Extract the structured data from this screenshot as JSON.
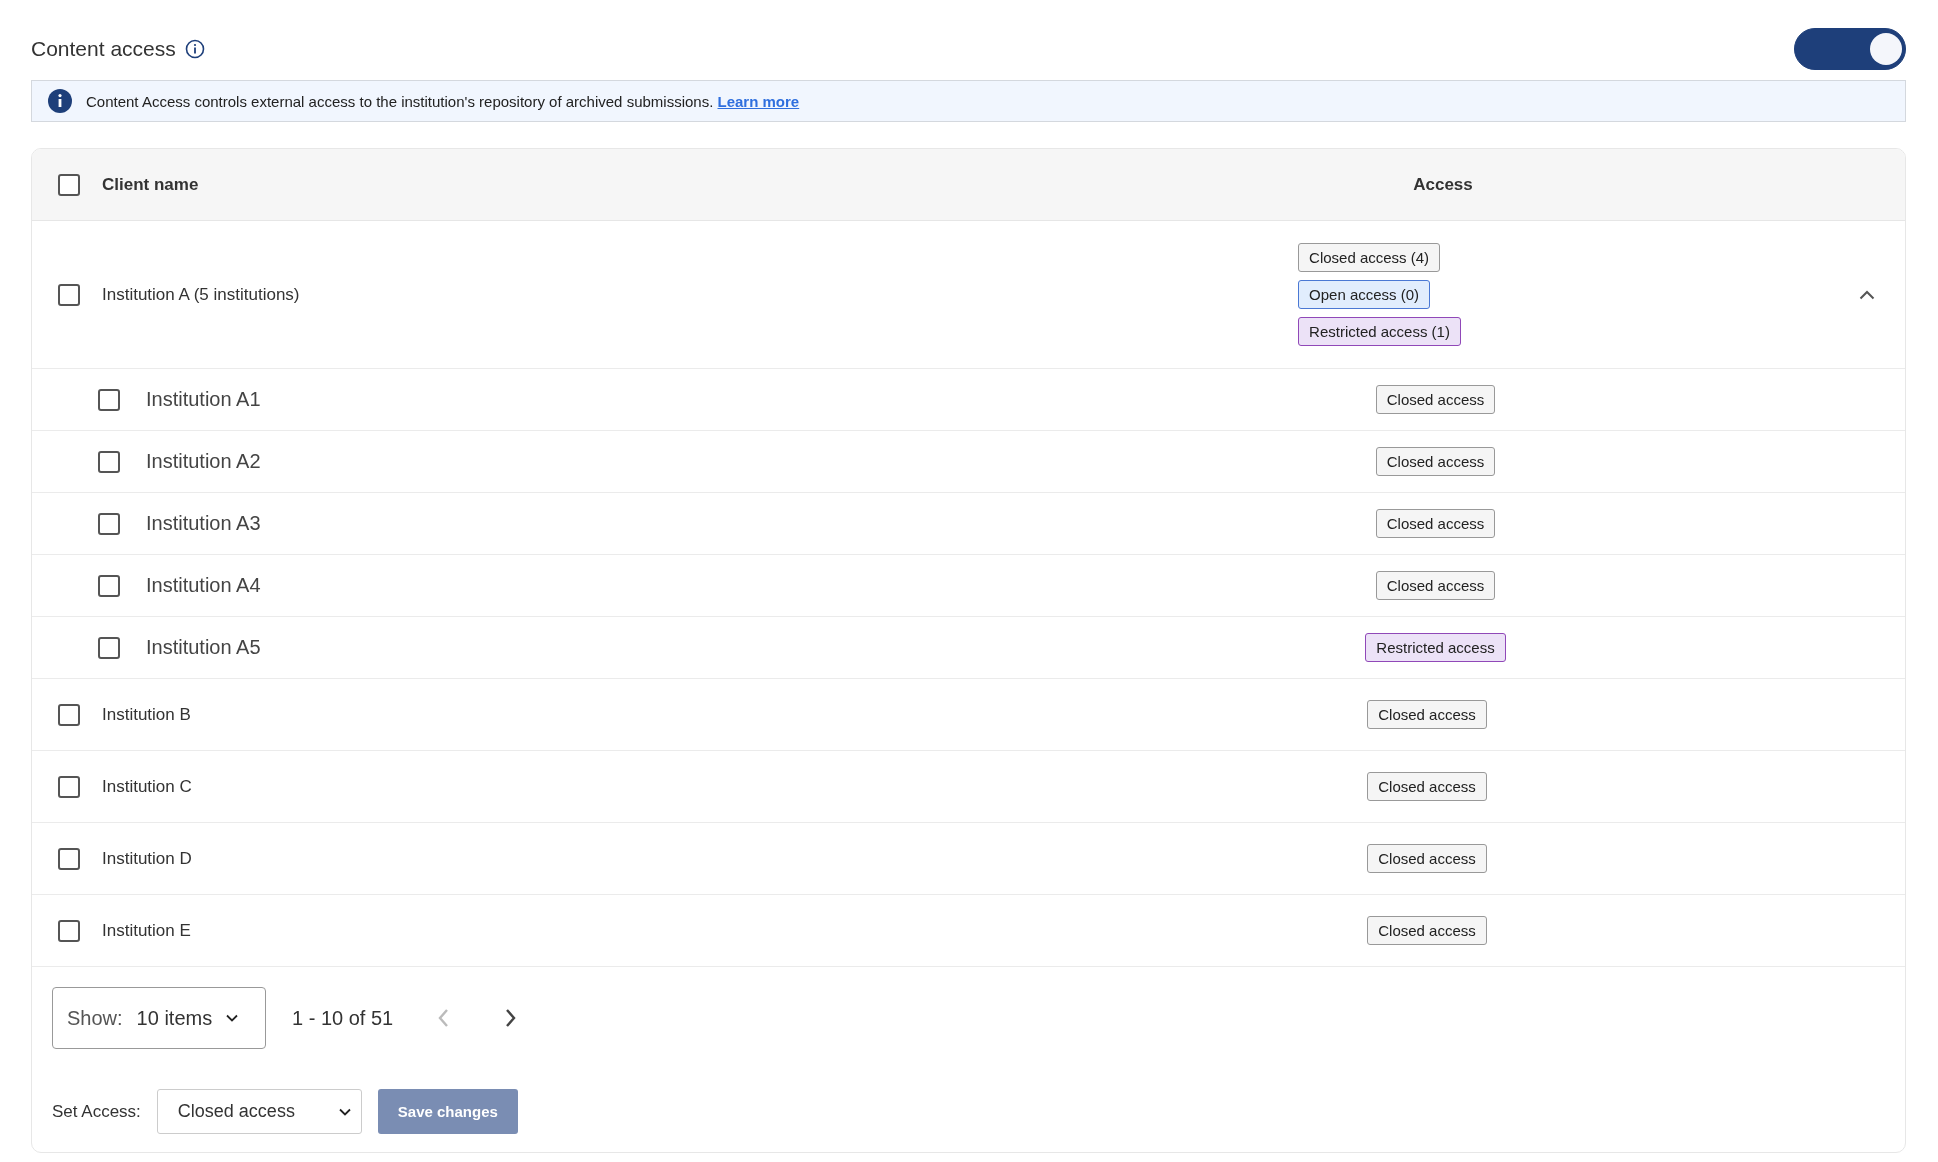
{
  "header": {
    "title": "Content access",
    "toggle": {
      "on": true
    }
  },
  "banner": {
    "text": "Content Access controls external access to the institution's repository of archived submissions.",
    "link": "Learn more"
  },
  "table": {
    "columns": [
      "Client name",
      "Access"
    ],
    "select_all": {
      "checked": false
    },
    "rows": [
      {
        "name": "Institution A (5 institutions)",
        "checked": false,
        "expanded": true,
        "badges": [
          {
            "label": "Closed access (4)",
            "kind": "closed"
          },
          {
            "label": "Open access (0)",
            "kind": "open"
          },
          {
            "label": "Restricted access (1)",
            "kind": "restricted"
          }
        ],
        "children": [
          {
            "name": "Institution A1",
            "checked": false,
            "badges": [
              {
                "label": "Closed access",
                "kind": "closed"
              }
            ]
          },
          {
            "name": "Institution A2",
            "checked": false,
            "badges": [
              {
                "label": "Closed access",
                "kind": "closed"
              }
            ]
          },
          {
            "name": "Institution A3",
            "checked": false,
            "badges": [
              {
                "label": "Closed access",
                "kind": "closed"
              }
            ]
          },
          {
            "name": "Institution A4",
            "checked": false,
            "badges": [
              {
                "label": "Closed access",
                "kind": "closed"
              }
            ]
          },
          {
            "name": "Institution A5",
            "checked": false,
            "badges": [
              {
                "label": "Restricted access",
                "kind": "restricted"
              }
            ]
          }
        ]
      },
      {
        "name": "Institution B",
        "checked": false,
        "badges": [
          {
            "label": "Closed access",
            "kind": "closed"
          }
        ]
      },
      {
        "name": "Institution C",
        "checked": false,
        "badges": [
          {
            "label": "Closed access",
            "kind": "closed"
          }
        ]
      },
      {
        "name": "Institution D",
        "checked": false,
        "badges": [
          {
            "label": "Closed access",
            "kind": "closed"
          }
        ]
      },
      {
        "name": "Institution E",
        "checked": false,
        "badges": [
          {
            "label": "Closed access",
            "kind": "closed"
          }
        ]
      }
    ]
  },
  "pagination": {
    "show_label": "Show:",
    "page_size": "10 items",
    "range": "1 - 10 of 51",
    "prev": {
      "disabled": true
    },
    "next": {
      "disabled": false
    }
  },
  "set_access": {
    "label": "Set Access:",
    "value": "Closed access",
    "button": "Save changes",
    "button_disabled": true
  }
}
